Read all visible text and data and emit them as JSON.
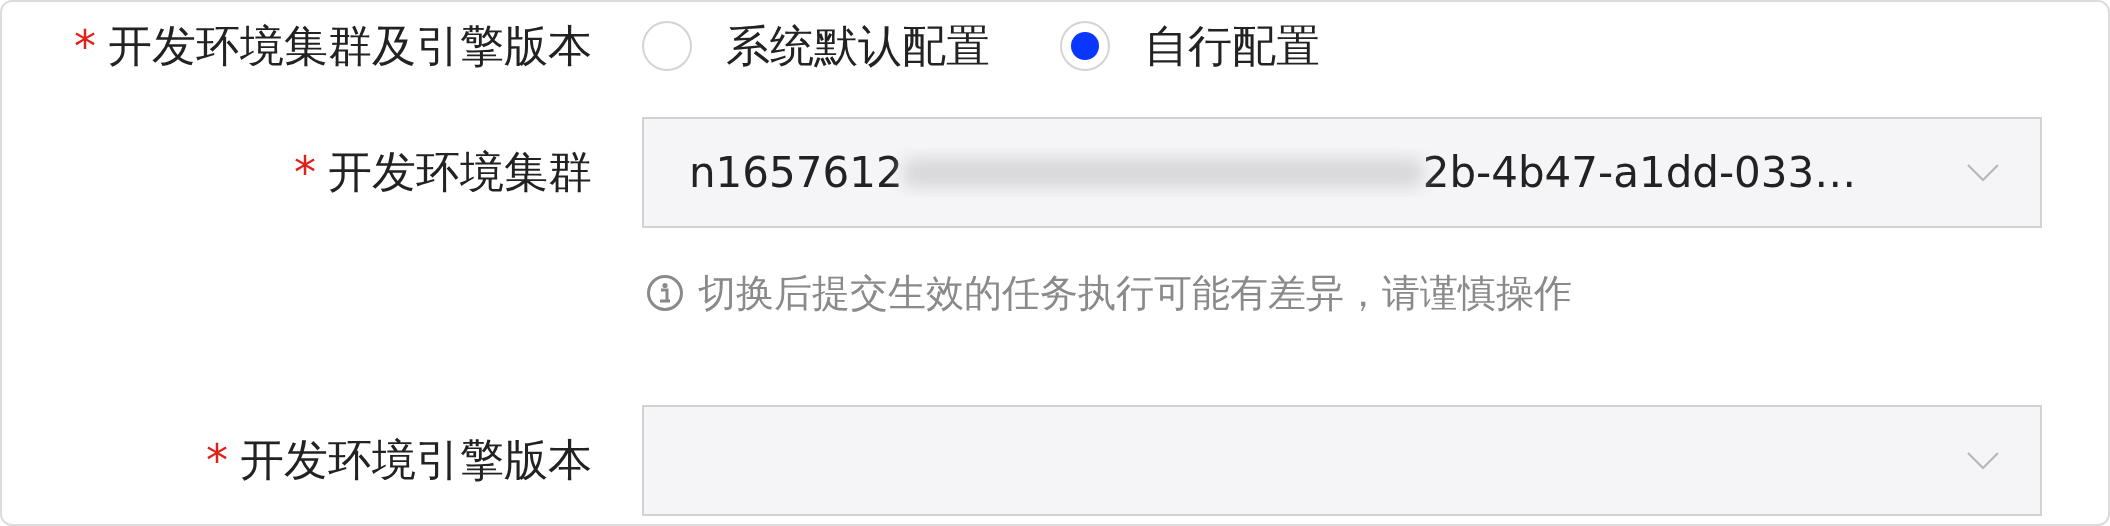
{
  "fields": [
    {
      "required_mark": "*",
      "label": "开发环境集群及引擎版本",
      "kind": "radio",
      "options": [
        {
          "label": "系统默认配置",
          "selected": false
        },
        {
          "label": "自行配置",
          "selected": true
        }
      ]
    },
    {
      "required_mark": "*",
      "label": "开发环境集群",
      "kind": "select",
      "value_start": "n1657612",
      "redacted": true,
      "value_end": "2b-4b47-a1dd-033…",
      "hint": "切换后提交生效的任务执行可能有差异，请谨慎操作"
    },
    {
      "required_mark": "*",
      "label": "开发环境引擎版本",
      "kind": "select"
    }
  ]
}
